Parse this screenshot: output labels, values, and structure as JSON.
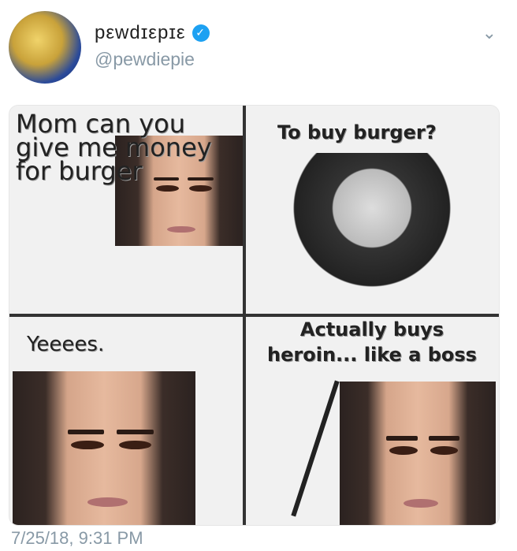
{
  "tweet": {
    "display_name": "pεwdɪεpɪε",
    "handle": "@pewdiepie",
    "verified_glyph": "✓",
    "menu_glyph": "⌄",
    "timestamp": "7/25/18, 9:31 PM"
  },
  "meme": {
    "panel1_text": "Mom can you give me money for burger",
    "panel2_text": "To buy burger?",
    "panel3_text": "Yeeees.",
    "panel4_text": "Actually buys heroin... like a boss"
  },
  "icons": {
    "verified": "verified-check-icon",
    "menu": "chevron-down-icon",
    "avatar": "pewdiepie-avatar"
  },
  "colors": {
    "verified": "#1da1f2",
    "secondary_text": "#8899a6",
    "primary_text": "#222222"
  }
}
